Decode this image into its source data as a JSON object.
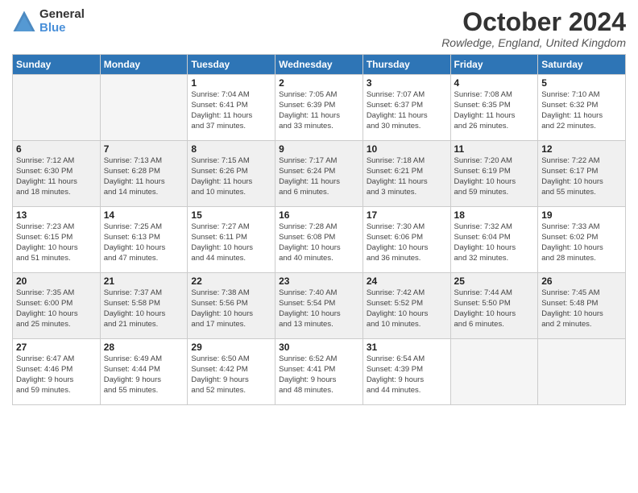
{
  "logo": {
    "general": "General",
    "blue": "Blue"
  },
  "title": "October 2024",
  "location": "Rowledge, England, United Kingdom",
  "days_of_week": [
    "Sunday",
    "Monday",
    "Tuesday",
    "Wednesday",
    "Thursday",
    "Friday",
    "Saturday"
  ],
  "weeks": [
    [
      {
        "day": "",
        "info": ""
      },
      {
        "day": "",
        "info": ""
      },
      {
        "day": "1",
        "info": "Sunrise: 7:04 AM\nSunset: 6:41 PM\nDaylight: 11 hours\nand 37 minutes."
      },
      {
        "day": "2",
        "info": "Sunrise: 7:05 AM\nSunset: 6:39 PM\nDaylight: 11 hours\nand 33 minutes."
      },
      {
        "day": "3",
        "info": "Sunrise: 7:07 AM\nSunset: 6:37 PM\nDaylight: 11 hours\nand 30 minutes."
      },
      {
        "day": "4",
        "info": "Sunrise: 7:08 AM\nSunset: 6:35 PM\nDaylight: 11 hours\nand 26 minutes."
      },
      {
        "day": "5",
        "info": "Sunrise: 7:10 AM\nSunset: 6:32 PM\nDaylight: 11 hours\nand 22 minutes."
      }
    ],
    [
      {
        "day": "6",
        "info": "Sunrise: 7:12 AM\nSunset: 6:30 PM\nDaylight: 11 hours\nand 18 minutes."
      },
      {
        "day": "7",
        "info": "Sunrise: 7:13 AM\nSunset: 6:28 PM\nDaylight: 11 hours\nand 14 minutes."
      },
      {
        "day": "8",
        "info": "Sunrise: 7:15 AM\nSunset: 6:26 PM\nDaylight: 11 hours\nand 10 minutes."
      },
      {
        "day": "9",
        "info": "Sunrise: 7:17 AM\nSunset: 6:24 PM\nDaylight: 11 hours\nand 6 minutes."
      },
      {
        "day": "10",
        "info": "Sunrise: 7:18 AM\nSunset: 6:21 PM\nDaylight: 11 hours\nand 3 minutes."
      },
      {
        "day": "11",
        "info": "Sunrise: 7:20 AM\nSunset: 6:19 PM\nDaylight: 10 hours\nand 59 minutes."
      },
      {
        "day": "12",
        "info": "Sunrise: 7:22 AM\nSunset: 6:17 PM\nDaylight: 10 hours\nand 55 minutes."
      }
    ],
    [
      {
        "day": "13",
        "info": "Sunrise: 7:23 AM\nSunset: 6:15 PM\nDaylight: 10 hours\nand 51 minutes."
      },
      {
        "day": "14",
        "info": "Sunrise: 7:25 AM\nSunset: 6:13 PM\nDaylight: 10 hours\nand 47 minutes."
      },
      {
        "day": "15",
        "info": "Sunrise: 7:27 AM\nSunset: 6:11 PM\nDaylight: 10 hours\nand 44 minutes."
      },
      {
        "day": "16",
        "info": "Sunrise: 7:28 AM\nSunset: 6:08 PM\nDaylight: 10 hours\nand 40 minutes."
      },
      {
        "day": "17",
        "info": "Sunrise: 7:30 AM\nSunset: 6:06 PM\nDaylight: 10 hours\nand 36 minutes."
      },
      {
        "day": "18",
        "info": "Sunrise: 7:32 AM\nSunset: 6:04 PM\nDaylight: 10 hours\nand 32 minutes."
      },
      {
        "day": "19",
        "info": "Sunrise: 7:33 AM\nSunset: 6:02 PM\nDaylight: 10 hours\nand 28 minutes."
      }
    ],
    [
      {
        "day": "20",
        "info": "Sunrise: 7:35 AM\nSunset: 6:00 PM\nDaylight: 10 hours\nand 25 minutes."
      },
      {
        "day": "21",
        "info": "Sunrise: 7:37 AM\nSunset: 5:58 PM\nDaylight: 10 hours\nand 21 minutes."
      },
      {
        "day": "22",
        "info": "Sunrise: 7:38 AM\nSunset: 5:56 PM\nDaylight: 10 hours\nand 17 minutes."
      },
      {
        "day": "23",
        "info": "Sunrise: 7:40 AM\nSunset: 5:54 PM\nDaylight: 10 hours\nand 13 minutes."
      },
      {
        "day": "24",
        "info": "Sunrise: 7:42 AM\nSunset: 5:52 PM\nDaylight: 10 hours\nand 10 minutes."
      },
      {
        "day": "25",
        "info": "Sunrise: 7:44 AM\nSunset: 5:50 PM\nDaylight: 10 hours\nand 6 minutes."
      },
      {
        "day": "26",
        "info": "Sunrise: 7:45 AM\nSunset: 5:48 PM\nDaylight: 10 hours\nand 2 minutes."
      }
    ],
    [
      {
        "day": "27",
        "info": "Sunrise: 6:47 AM\nSunset: 4:46 PM\nDaylight: 9 hours\nand 59 minutes."
      },
      {
        "day": "28",
        "info": "Sunrise: 6:49 AM\nSunset: 4:44 PM\nDaylight: 9 hours\nand 55 minutes."
      },
      {
        "day": "29",
        "info": "Sunrise: 6:50 AM\nSunset: 4:42 PM\nDaylight: 9 hours\nand 52 minutes."
      },
      {
        "day": "30",
        "info": "Sunrise: 6:52 AM\nSunset: 4:41 PM\nDaylight: 9 hours\nand 48 minutes."
      },
      {
        "day": "31",
        "info": "Sunrise: 6:54 AM\nSunset: 4:39 PM\nDaylight: 9 hours\nand 44 minutes."
      },
      {
        "day": "",
        "info": ""
      },
      {
        "day": "",
        "info": ""
      }
    ]
  ]
}
